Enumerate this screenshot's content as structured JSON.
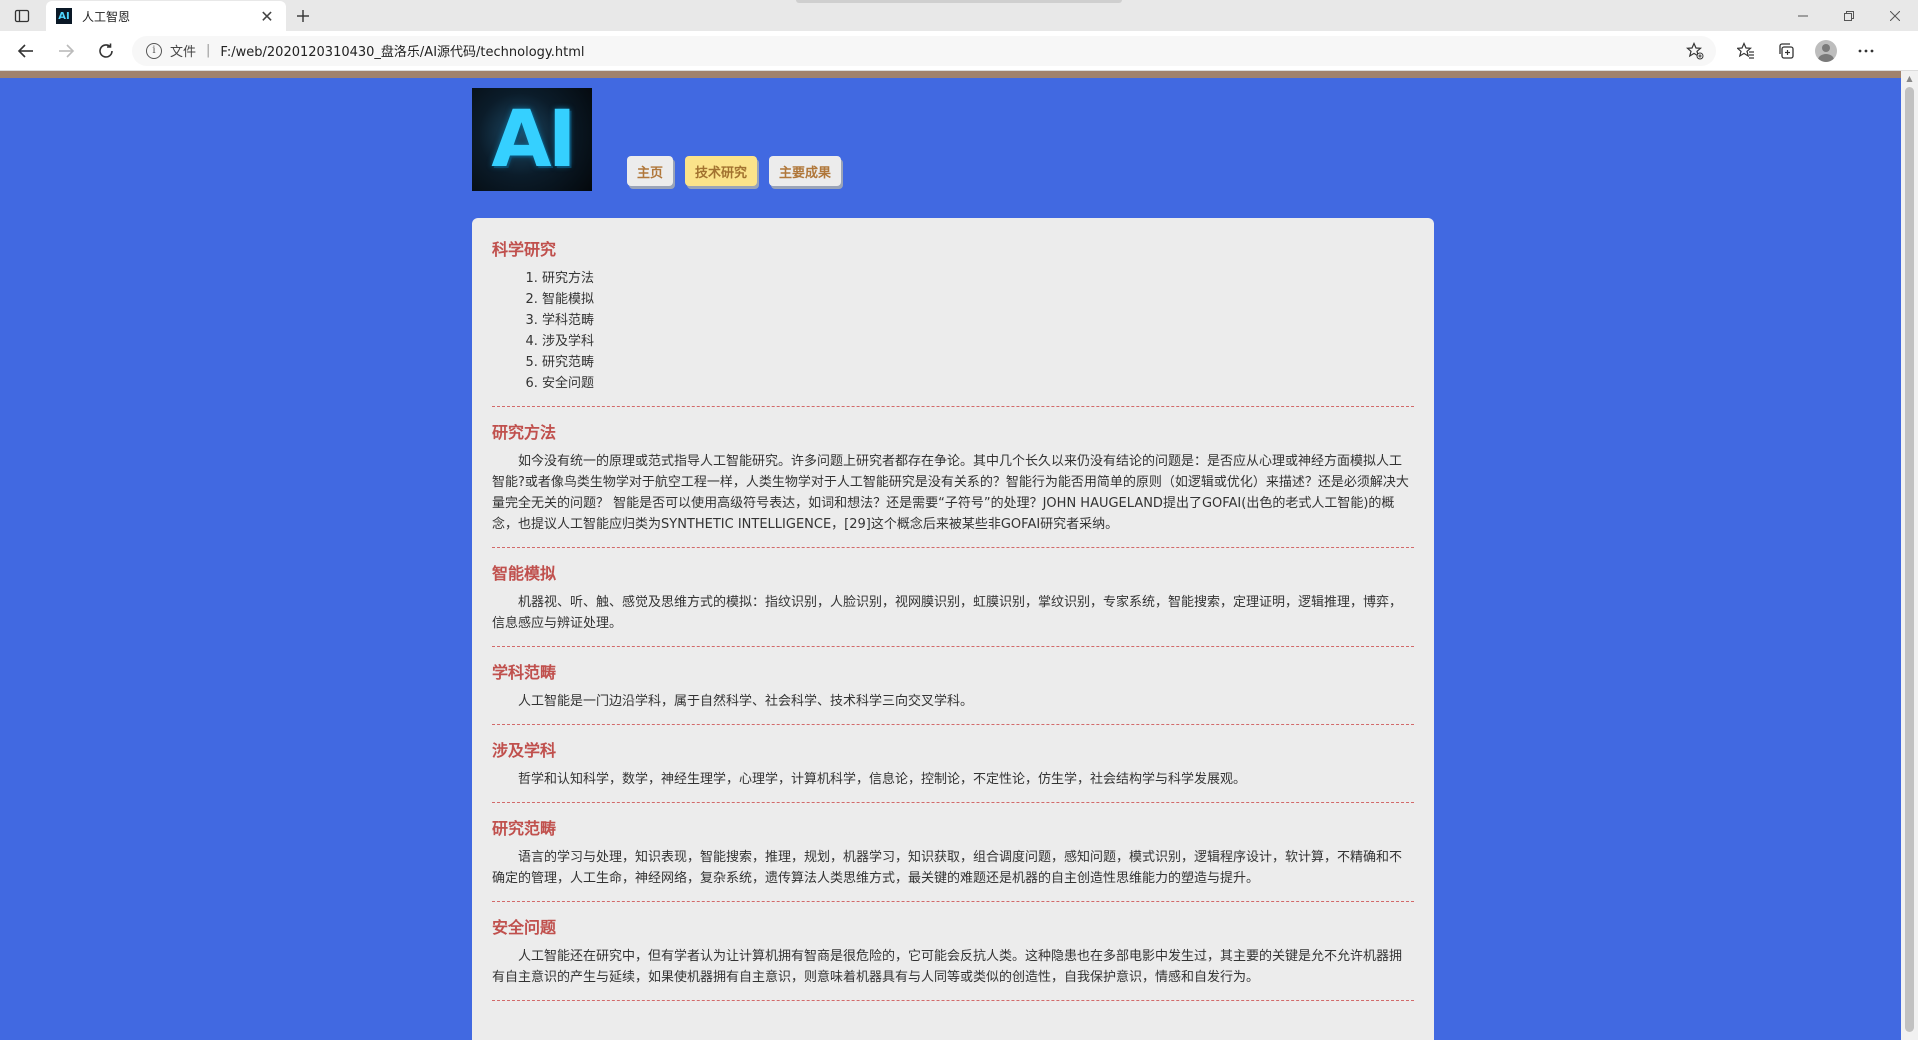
{
  "browser": {
    "tab_title": "人工智恩",
    "favicon_text": "AI",
    "url_label": "文件",
    "url": "F:/web/2020120310430_盘洛乐/AI源代码/technology.html"
  },
  "colors": {
    "page_bg": "#4169e1",
    "top_strip": "#a0826d",
    "content_bg": "#ececec",
    "heading": "#c0504d",
    "nav_text": "#b0773a",
    "nav_active_bg": "#fbe38a"
  },
  "header": {
    "logo_text": "AI",
    "nav": [
      {
        "label": "主页"
      },
      {
        "label": "技术研究"
      },
      {
        "label": "主要成果"
      }
    ]
  },
  "toc": {
    "title": "科学研究",
    "items": [
      "研究方法",
      "智能模拟",
      "学科范畴",
      "涉及学科",
      "研究范畴",
      "安全问题"
    ]
  },
  "sections": [
    {
      "title": "研究方法",
      "text": "如今没有统一的原理或范式指导人工智能研究。许多问题上研究者都存在争论。其中几个长久以来仍没有结论的问题是：是否应从心理或神经方面模拟人工智能?或者像鸟类生物学对于航空工程一样，人类生物学对于人工智能研究是没有关系的？智能行为能否用简单的原则（如逻辑或优化）来描述？还是必须解决大量完全无关的问题？ 智能是否可以使用高级符号表达，如词和想法？还是需要“子符号”的处理？JOHN HAUGELAND提出了GOFAI(出色的老式人工智能)的概念，也提议人工智能应归类为SYNTHETIC INTELLIGENCE，[29]这个概念后来被某些非GOFAI研究者采纳。"
    },
    {
      "title": "智能模拟",
      "text": "机器视、听、触、感觉及思维方式的模拟：指纹识别，人脸识别，视网膜识别，虹膜识别，掌纹识别，专家系统，智能搜索，定理证明，逻辑推理，博弈，信息感应与辨证处理。"
    },
    {
      "title": "学科范畴",
      "text": "人工智能是一门边沿学科，属于自然科学、社会科学、技术科学三向交叉学科。"
    },
    {
      "title": "涉及学科",
      "text": "哲学和认知科学，数学，神经生理学，心理学，计算机科学，信息论，控制论，不定性论，仿生学，社会结构学与科学发展观。"
    },
    {
      "title": "研究范畴",
      "text": "语言的学习与处理，知识表现，智能搜索，推理，规划，机器学习，知识获取，组合调度问题，感知问题，模式识别，逻辑程序设计，软计算，不精确和不确定的管理，人工生命，神经网络，复杂系统，遗传算法人类思维方式，最关键的难题还是机器的自主创造性思维能力的塑造与提升。"
    },
    {
      "title": "安全问题",
      "text": "人工智能还在研究中，但有学者认为让计算机拥有智商是很危险的，它可能会反抗人类。这种隐患也在多部电影中发生过，其主要的关键是允不允许机器拥有自主意识的产生与延续，如果使机器拥有自主意识，则意味着机器具有与人同等或类似的创造性，自我保护意识，情感和自发行为。"
    }
  ]
}
